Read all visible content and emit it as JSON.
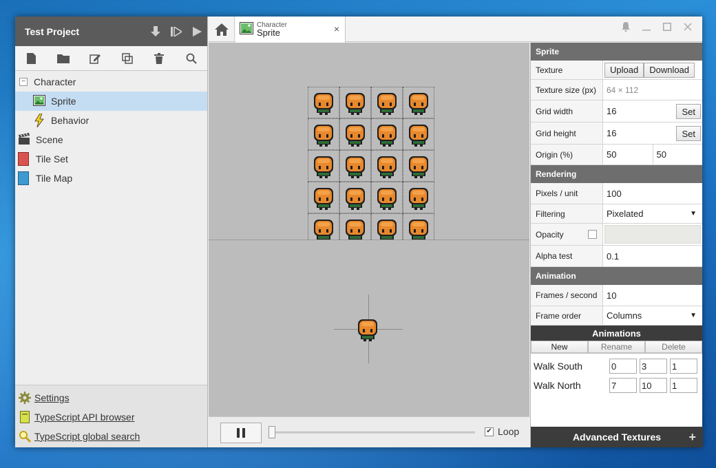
{
  "project": {
    "title": "Test Project"
  },
  "tree": [
    {
      "label": "Character",
      "kind": "folder"
    },
    {
      "label": "Sprite",
      "kind": "sprite"
    },
    {
      "label": "Behavior",
      "kind": "behavior"
    },
    {
      "label": "Scene",
      "kind": "scene"
    },
    {
      "label": "Tile Set",
      "kind": "tileset"
    },
    {
      "label": "Tile Map",
      "kind": "tilemap"
    }
  ],
  "links": [
    {
      "label": "Settings"
    },
    {
      "label": "TypeScript API browser"
    },
    {
      "label": "TypeScript global search"
    }
  ],
  "tab": {
    "sub": "Character",
    "main": "Sprite",
    "close": "×"
  },
  "props": {
    "sprite_header": "Sprite",
    "texture_label": "Texture",
    "upload": "Upload",
    "download": "Download",
    "texture_size_label": "Texture size (px)",
    "texture_size": "64 × 112",
    "grid_width_label": "Grid width",
    "grid_width": "16",
    "grid_height_label": "Grid height",
    "grid_height": "16",
    "set": "Set",
    "origin_label": "Origin (%)",
    "origin_x": "50",
    "origin_y": "50",
    "rendering_header": "Rendering",
    "ppu_label": "Pixels / unit",
    "ppu": "100",
    "filtering_label": "Filtering",
    "filtering": "Pixelated",
    "opacity_label": "Opacity",
    "alpha_label": "Alpha test",
    "alpha": "0.1",
    "animation_header": "Animation",
    "fps_label": "Frames / second",
    "fps": "10",
    "frame_order_label": "Frame order",
    "frame_order": "Columns"
  },
  "animations": {
    "header": "Animations",
    "new": "New",
    "rename": "Rename",
    "delete": "Delete",
    "items": [
      {
        "name": "Walk South",
        "start": "0",
        "end": "3",
        "step": "1"
      },
      {
        "name": "Walk North",
        "start": "7",
        "end": "10",
        "step": "1"
      }
    ]
  },
  "advanced": {
    "label": "Advanced Textures",
    "plus": "+"
  },
  "playback": {
    "loop_label": "Loop",
    "loop_checked": true
  },
  "colors": {
    "sprite_orange": "#e8882c",
    "sprite_dark": "#1e1e1e",
    "selection": "#c5ddf2",
    "header_gray": "#6e6e6e"
  }
}
